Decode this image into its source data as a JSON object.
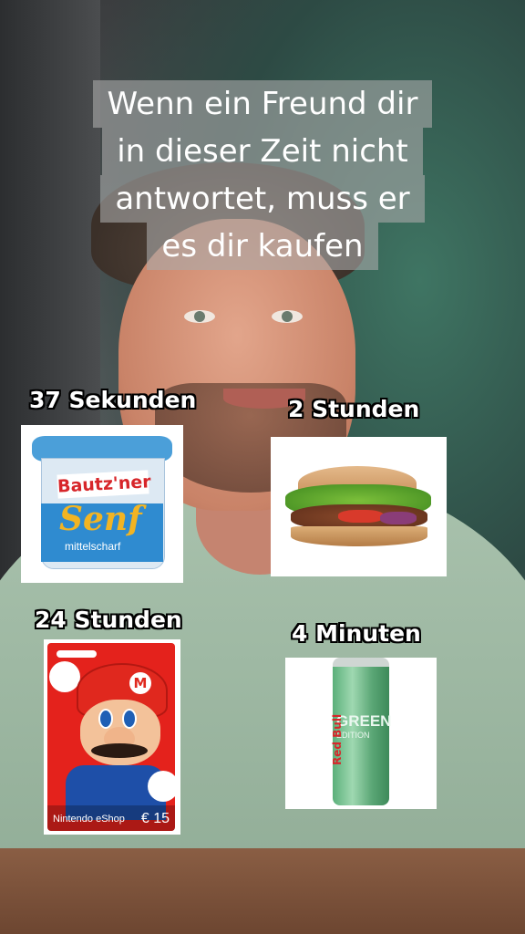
{
  "caption": {
    "lines": [
      "Wenn ein Freund dir",
      "in dieser Zeit nicht",
      "antwortet, muss er",
      "es dir kaufen"
    ]
  },
  "items": [
    {
      "label": "37 Sekunden",
      "product": "Bautz'ner Senf mittelscharf",
      "brand": "Bautz'ner",
      "name": "Senf",
      "sub": "mittelscharf"
    },
    {
      "label": "2 Stunden",
      "product": "Döner"
    },
    {
      "label": "24 Stunden",
      "product": "Nintendo eShop card",
      "card_name": "Nintendo eShop",
      "price": "€ 15"
    },
    {
      "label": "4 Minuten",
      "product": "Red Bull Green Edition",
      "can_text": "GREEN",
      "can_sub": "EDITION",
      "can_brand": "Red Bull"
    }
  ],
  "colors": {
    "caption_bg": "#aaaaaa",
    "label_text": "#ffffff",
    "label_outline": "#000000"
  }
}
